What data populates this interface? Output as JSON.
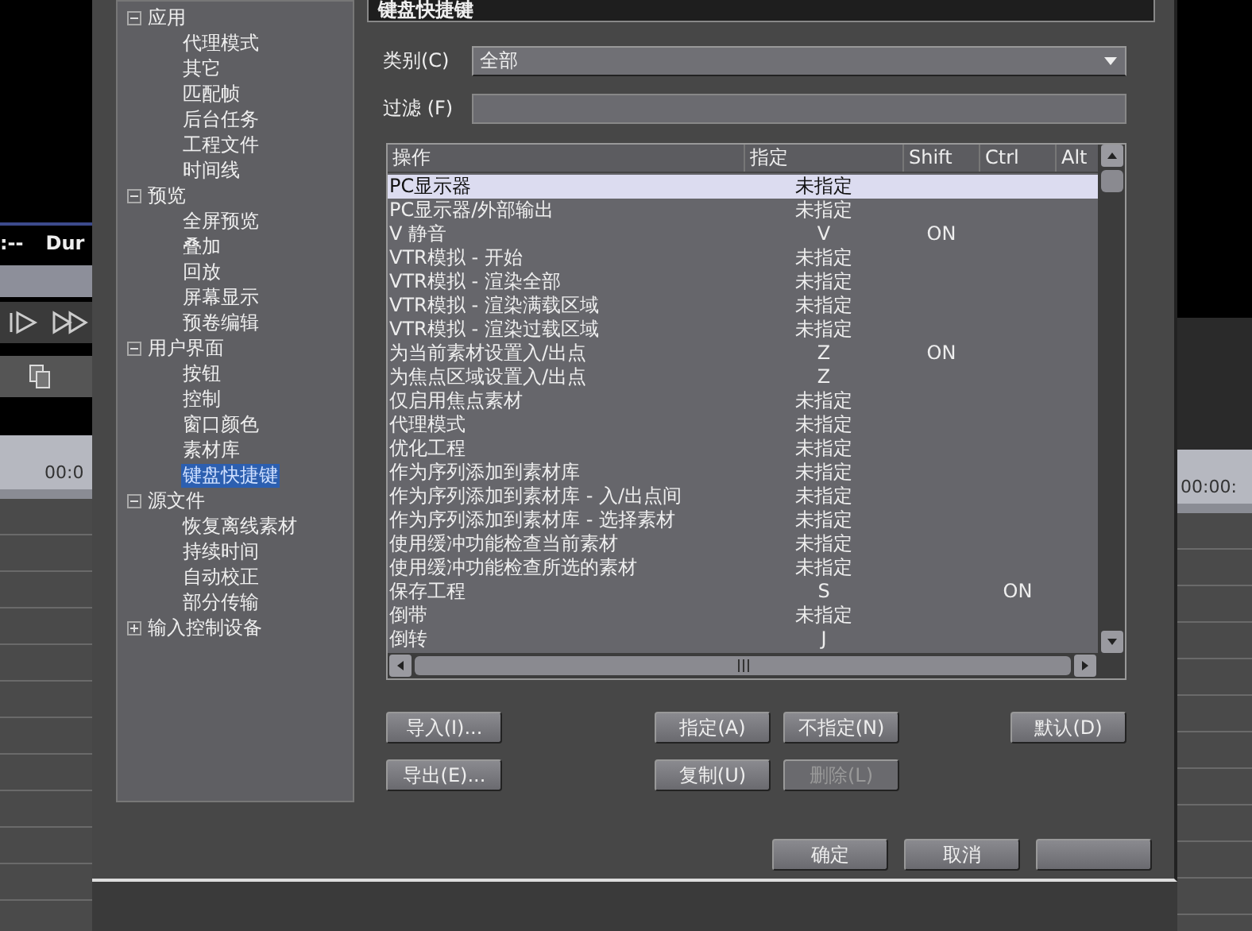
{
  "background_left": {
    "time_text": ":--",
    "duration_label": "Dur",
    "timeline_time": "00:0"
  },
  "background_right": {
    "timeline_time": "00:00:"
  },
  "dialog": {
    "title": "键盘快捷键"
  },
  "tree": [
    {
      "label": "应用",
      "expanded": true,
      "selected": false,
      "children": [
        {
          "label": "代理模式",
          "selected": false
        },
        {
          "label": "其它",
          "selected": false
        },
        {
          "label": "匹配帧",
          "selected": false
        },
        {
          "label": "后台任务",
          "selected": false
        },
        {
          "label": "工程文件",
          "selected": false
        },
        {
          "label": "时间线",
          "selected": false
        }
      ]
    },
    {
      "label": "预览",
      "expanded": true,
      "selected": false,
      "children": [
        {
          "label": "全屏预览",
          "selected": false
        },
        {
          "label": "叠加",
          "selected": false
        },
        {
          "label": "回放",
          "selected": false
        },
        {
          "label": "屏幕显示",
          "selected": false
        },
        {
          "label": "预卷编辑",
          "selected": false
        }
      ]
    },
    {
      "label": "用户界面",
      "expanded": true,
      "selected": false,
      "children": [
        {
          "label": "按钮",
          "selected": false
        },
        {
          "label": "控制",
          "selected": false
        },
        {
          "label": "窗口颜色",
          "selected": false
        },
        {
          "label": "素材库",
          "selected": false
        },
        {
          "label": "键盘快捷键",
          "selected": true
        }
      ]
    },
    {
      "label": "源文件",
      "expanded": true,
      "selected": false,
      "children": [
        {
          "label": "恢复离线素材",
          "selected": false
        },
        {
          "label": "持续时间",
          "selected": false
        },
        {
          "label": "自动校正",
          "selected": false
        },
        {
          "label": "部分传输",
          "selected": false
        }
      ]
    },
    {
      "label": "输入控制设备",
      "expanded": false,
      "selected": false
    }
  ],
  "category": {
    "label": "类别(C)",
    "value": "全部"
  },
  "filter": {
    "label": "过滤 (F)"
  },
  "table": {
    "columns": [
      "操作",
      "指定",
      "Shift",
      "Ctrl",
      "Alt"
    ],
    "rows": [
      {
        "cells": [
          "PC显示器",
          "未指定",
          "",
          "",
          ""
        ],
        "selected": true
      },
      {
        "cells": [
          "PC显示器/外部输出",
          "未指定",
          "",
          "",
          ""
        ],
        "selected": false
      },
      {
        "cells": [
          "V 静音",
          "V",
          "ON",
          "",
          ""
        ],
        "selected": false
      },
      {
        "cells": [
          "VTR模拟 - 开始",
          "未指定",
          "",
          "",
          ""
        ],
        "selected": false
      },
      {
        "cells": [
          "VTR模拟 - 渲染全部",
          "未指定",
          "",
          "",
          ""
        ],
        "selected": false
      },
      {
        "cells": [
          "VTR模拟 - 渲染满载区域",
          "未指定",
          "",
          "",
          ""
        ],
        "selected": false
      },
      {
        "cells": [
          "VTR模拟 - 渲染过载区域",
          "未指定",
          "",
          "",
          ""
        ],
        "selected": false
      },
      {
        "cells": [
          "为当前素材设置入/出点",
          "Z",
          "ON",
          "",
          ""
        ],
        "selected": false
      },
      {
        "cells": [
          "为焦点区域设置入/出点",
          "Z",
          "",
          "",
          ""
        ],
        "selected": false
      },
      {
        "cells": [
          "仅启用焦点素材",
          "未指定",
          "",
          "",
          ""
        ],
        "selected": false
      },
      {
        "cells": [
          "代理模式",
          "未指定",
          "",
          "",
          ""
        ],
        "selected": false
      },
      {
        "cells": [
          "优化工程",
          "未指定",
          "",
          "",
          ""
        ],
        "selected": false
      },
      {
        "cells": [
          "作为序列添加到素材库",
          "未指定",
          "",
          "",
          ""
        ],
        "selected": false
      },
      {
        "cells": [
          "作为序列添加到素材库 - 入/出点间",
          "未指定",
          "",
          "",
          ""
        ],
        "selected": false
      },
      {
        "cells": [
          "作为序列添加到素材库 - 选择素材",
          "未指定",
          "",
          "",
          ""
        ],
        "selected": false
      },
      {
        "cells": [
          "使用缓冲功能检查当前素材",
          "未指定",
          "",
          "",
          ""
        ],
        "selected": false
      },
      {
        "cells": [
          "使用缓冲功能检查所选的素材",
          "未指定",
          "",
          "",
          ""
        ],
        "selected": false
      },
      {
        "cells": [
          "保存工程",
          "S",
          "",
          "ON",
          ""
        ],
        "selected": false
      },
      {
        "cells": [
          "倒带",
          "未指定",
          "",
          "",
          ""
        ],
        "selected": false
      },
      {
        "cells": [
          "倒转",
          "J",
          "",
          "",
          ""
        ],
        "selected": false
      }
    ]
  },
  "file_buttons": [
    {
      "label": "导入(I)...",
      "disabled": false
    },
    {
      "label": "导出(E)...",
      "disabled": false
    }
  ],
  "edit_buttons": [
    {
      "label": "指定(A)",
      "disabled": false
    },
    {
      "label": "不指定(N)",
      "disabled": false
    },
    {
      "label": "复制(U)",
      "disabled": false
    },
    {
      "label": "删除(L)",
      "disabled": true
    }
  ],
  "default_button": {
    "label": "默认(D)",
    "disabled": false
  },
  "footer_buttons": [
    {
      "label": "确定"
    },
    {
      "label": "取消"
    }
  ]
}
